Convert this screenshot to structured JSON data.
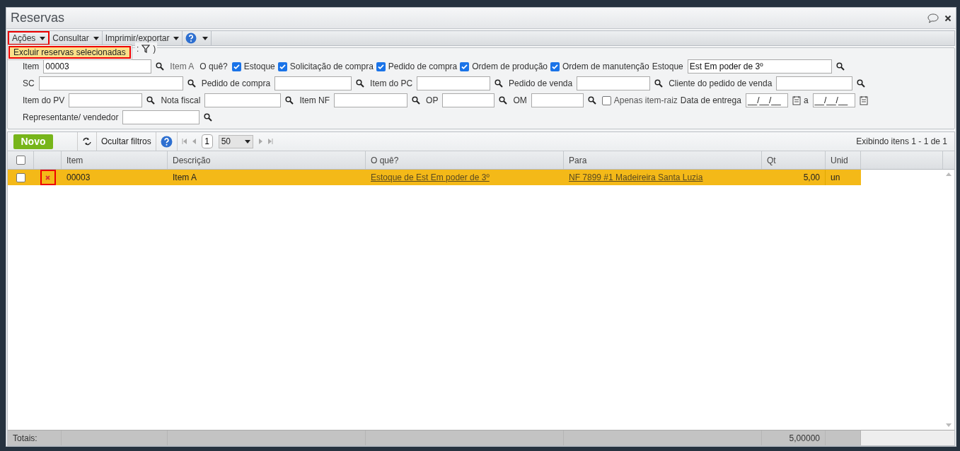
{
  "window": {
    "title": "Reservas"
  },
  "menu_bar": [
    {
      "label": "Ações",
      "highlighted": true,
      "kind": "menu"
    },
    {
      "label": "Consultar",
      "highlighted": false,
      "kind": "menu"
    },
    {
      "label": "Imprimir/exportar",
      "highlighted": false,
      "kind": "menu"
    },
    {
      "kind": "help"
    }
  ],
  "dropdown": {
    "items": [
      {
        "label": "Excluir reservas selecionadas",
        "highlighted": true
      }
    ]
  },
  "filter_legend": {
    "before": ":",
    "after": ")"
  },
  "filters": [
    [
      {
        "kind": "lookup",
        "label": "Item",
        "value": "00003"
      },
      {
        "kind": "note",
        "label": "Item A"
      },
      {
        "kind": "label",
        "label": "O quê?"
      },
      {
        "kind": "check",
        "label": "Estoque",
        "checked": true
      },
      {
        "kind": "check",
        "label": "Solicitação de compra",
        "checked": true
      },
      {
        "kind": "check",
        "label": "Pedido de compra",
        "checked": true
      },
      {
        "kind": "check",
        "label": "Ordem de produção",
        "checked": true
      },
      {
        "kind": "check",
        "label": "Ordem de manutenção",
        "checked": true
      },
      {
        "kind": "lookup",
        "label": "Estoque",
        "value": "Est Em poder de 3º"
      }
    ],
    [
      {
        "kind": "lookup",
        "label": "SC"
      },
      {
        "kind": "lookup",
        "label": "Pedido de compra"
      },
      {
        "kind": "lookup",
        "label": "Item do PC"
      },
      {
        "kind": "lookup",
        "label": "Pedido de venda"
      },
      {
        "kind": "lookup",
        "label": "Cliente do pedido de venda"
      }
    ],
    [
      {
        "kind": "lookup",
        "label": "Item do PV"
      },
      {
        "kind": "lookup",
        "label": "Nota fiscal"
      },
      {
        "kind": "lookup",
        "label": "Item NF"
      },
      {
        "kind": "lookup",
        "label": "OP"
      },
      {
        "kind": "lookup",
        "label": "OM"
      },
      {
        "kind": "check",
        "label": "Apenas item-raiz",
        "checked": false
      },
      {
        "kind": "date",
        "label": "Data de entrega",
        "value": "__/__/__"
      },
      {
        "kind": "date",
        "label": "a",
        "value": "__/__/__"
      }
    ],
    [
      {
        "kind": "lookup",
        "label": "Representante/ vendedor"
      }
    ]
  ],
  "grid_toolbar": {
    "new_button": "Novo",
    "hide_filters": "Ocultar filtros",
    "page": "1",
    "page_size": "50",
    "summary": "Exibindo itens 1 - 1 de 1"
  },
  "table": {
    "all_checked": false,
    "columns": [
      "Item",
      "Descrição",
      "O quê?",
      "Para",
      "Qt",
      "Unid"
    ],
    "rows": [
      {
        "selected": true,
        "checked": false,
        "delete_highlighted": true,
        "cells": [
          "00003",
          "Item A",
          "Estoque de Est Em poder de 3º",
          "NF 7899 #1 Madeireira Santa Luzia",
          "5,00",
          "un"
        ]
      }
    ],
    "totals": {
      "label": "Totais:",
      "qt": "5,00000"
    }
  }
}
